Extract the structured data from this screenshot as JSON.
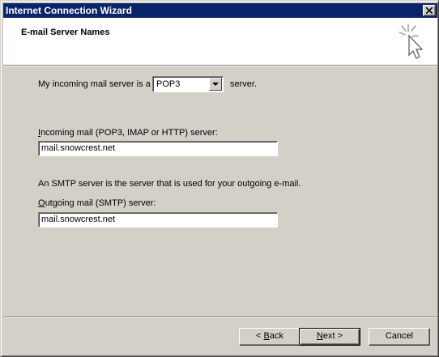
{
  "window": {
    "title": "Internet Connection Wizard"
  },
  "header": {
    "title": "E-mail Server Names"
  },
  "form": {
    "incoming_type_prefix": "My incoming mail server is a",
    "incoming_type_value": "POP3",
    "incoming_type_suffix": "server.",
    "incoming_label_mnemonic": "I",
    "incoming_label_rest": "ncoming mail (POP3, IMAP or HTTP) server:",
    "incoming_value": "mail.snowcrest.net",
    "smtp_note": "An SMTP server is the server that is used for your outgoing e-mail.",
    "outgoing_label_mnemonic": "O",
    "outgoing_label_rest": "utgoing mail (SMTP) server:",
    "outgoing_value": "mail.snowcrest.net"
  },
  "buttons": {
    "back_prefix": "< ",
    "back_mnemonic": "B",
    "back_rest": "ack",
    "next_mnemonic": "N",
    "next_rest": "ext >",
    "cancel": "Cancel"
  },
  "icons": {
    "close": "close-icon",
    "wizard": "cursor-sparkle-icon",
    "dropdown": "chevron-down-icon"
  },
  "colors": {
    "titlebar": "#0a246a",
    "face": "#d4d0c8",
    "header_bg": "#ffffff"
  }
}
